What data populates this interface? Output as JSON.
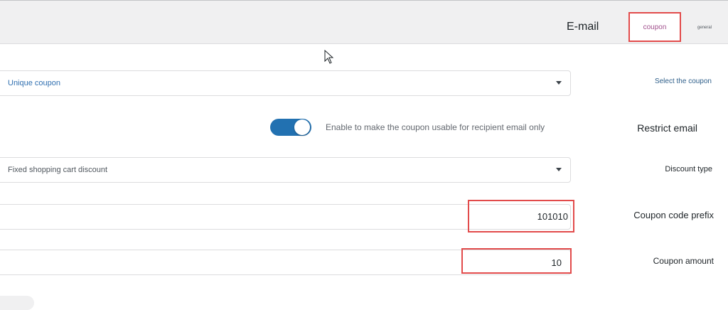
{
  "tabs": {
    "email": "E-mail",
    "coupon": "coupon",
    "general": "general"
  },
  "coupon_select": {
    "label": "Select the coupon",
    "value": "Unique coupon"
  },
  "restrict_email": {
    "label": "Restrict email",
    "toggle_text": "Enable to make the coupon usable for recipient email only",
    "enabled": true
  },
  "discount_type": {
    "label": "Discount type",
    "value": "Fixed shopping cart discount"
  },
  "coupon_code_prefix": {
    "label": "Coupon code prefix",
    "value": "101010"
  },
  "coupon_amount": {
    "label": "Coupon amount",
    "value": "10"
  },
  "colors": {
    "accent": "#2271b1",
    "highlight": "#e24b4b",
    "active_tab": "#a2528e"
  }
}
